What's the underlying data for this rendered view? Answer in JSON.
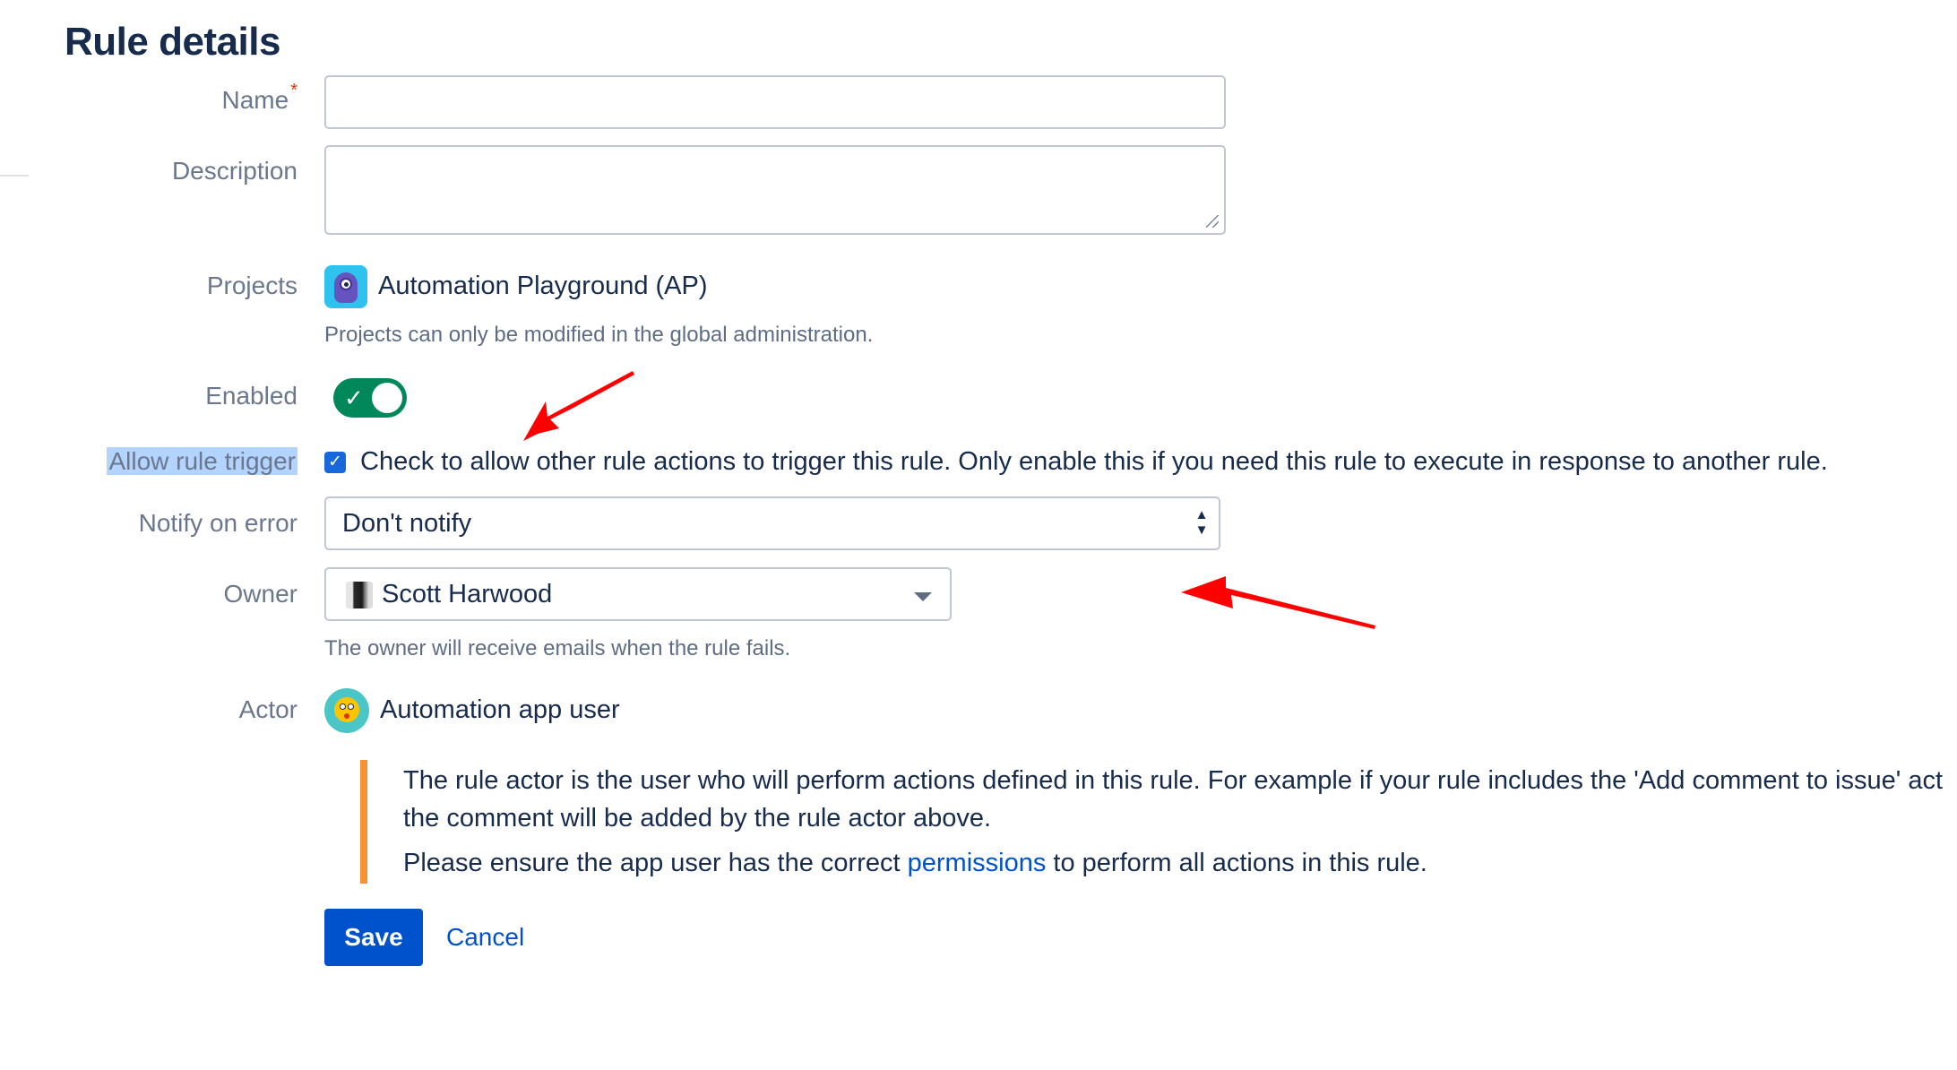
{
  "page": {
    "title": "Rule details"
  },
  "form": {
    "name": {
      "label": "Name",
      "required_mark": "*",
      "value": ""
    },
    "description": {
      "label": "Description",
      "value": ""
    },
    "projects": {
      "label": "Projects",
      "project_name": "Automation Playground (AP)",
      "help": "Projects can only be modified in the global administration."
    },
    "enabled": {
      "label": "Enabled",
      "state": "on"
    },
    "allow_rule_trigger": {
      "label": "Allow rule trigger",
      "checked": true,
      "text": "Check to allow other rule actions to trigger this rule. Only enable this if you need this rule to execute in response to another rule."
    },
    "notify_on_error": {
      "label": "Notify on error",
      "selected": "Don't notify"
    },
    "owner": {
      "label": "Owner",
      "selected": "Scott Harwood",
      "help": "The owner will receive emails when the rule fails."
    },
    "actor": {
      "label": "Actor",
      "name": "Automation app user",
      "note_line1": "The rule actor is the user who will perform actions defined in this rule. For example if your rule includes the 'Add comment to issue' act",
      "note_line2": "the comment will be added by the rule actor above.",
      "note_line3_before": "Please ensure the app user has the correct",
      "note_link": "permissions",
      "note_line3_after": "to perform all actions in this rule."
    }
  },
  "buttons": {
    "save": "Save",
    "cancel": "Cancel"
  },
  "colors": {
    "primary": "#0052cc",
    "toggle_on": "#00875a",
    "note_accent": "#f79232",
    "annotation_arrow": "#ff0000",
    "required": "#de350b"
  },
  "icons": {
    "project": "project-monster-icon",
    "owner_avatar": "user-avatar",
    "actor_avatar": "bot-avatar-icon"
  }
}
